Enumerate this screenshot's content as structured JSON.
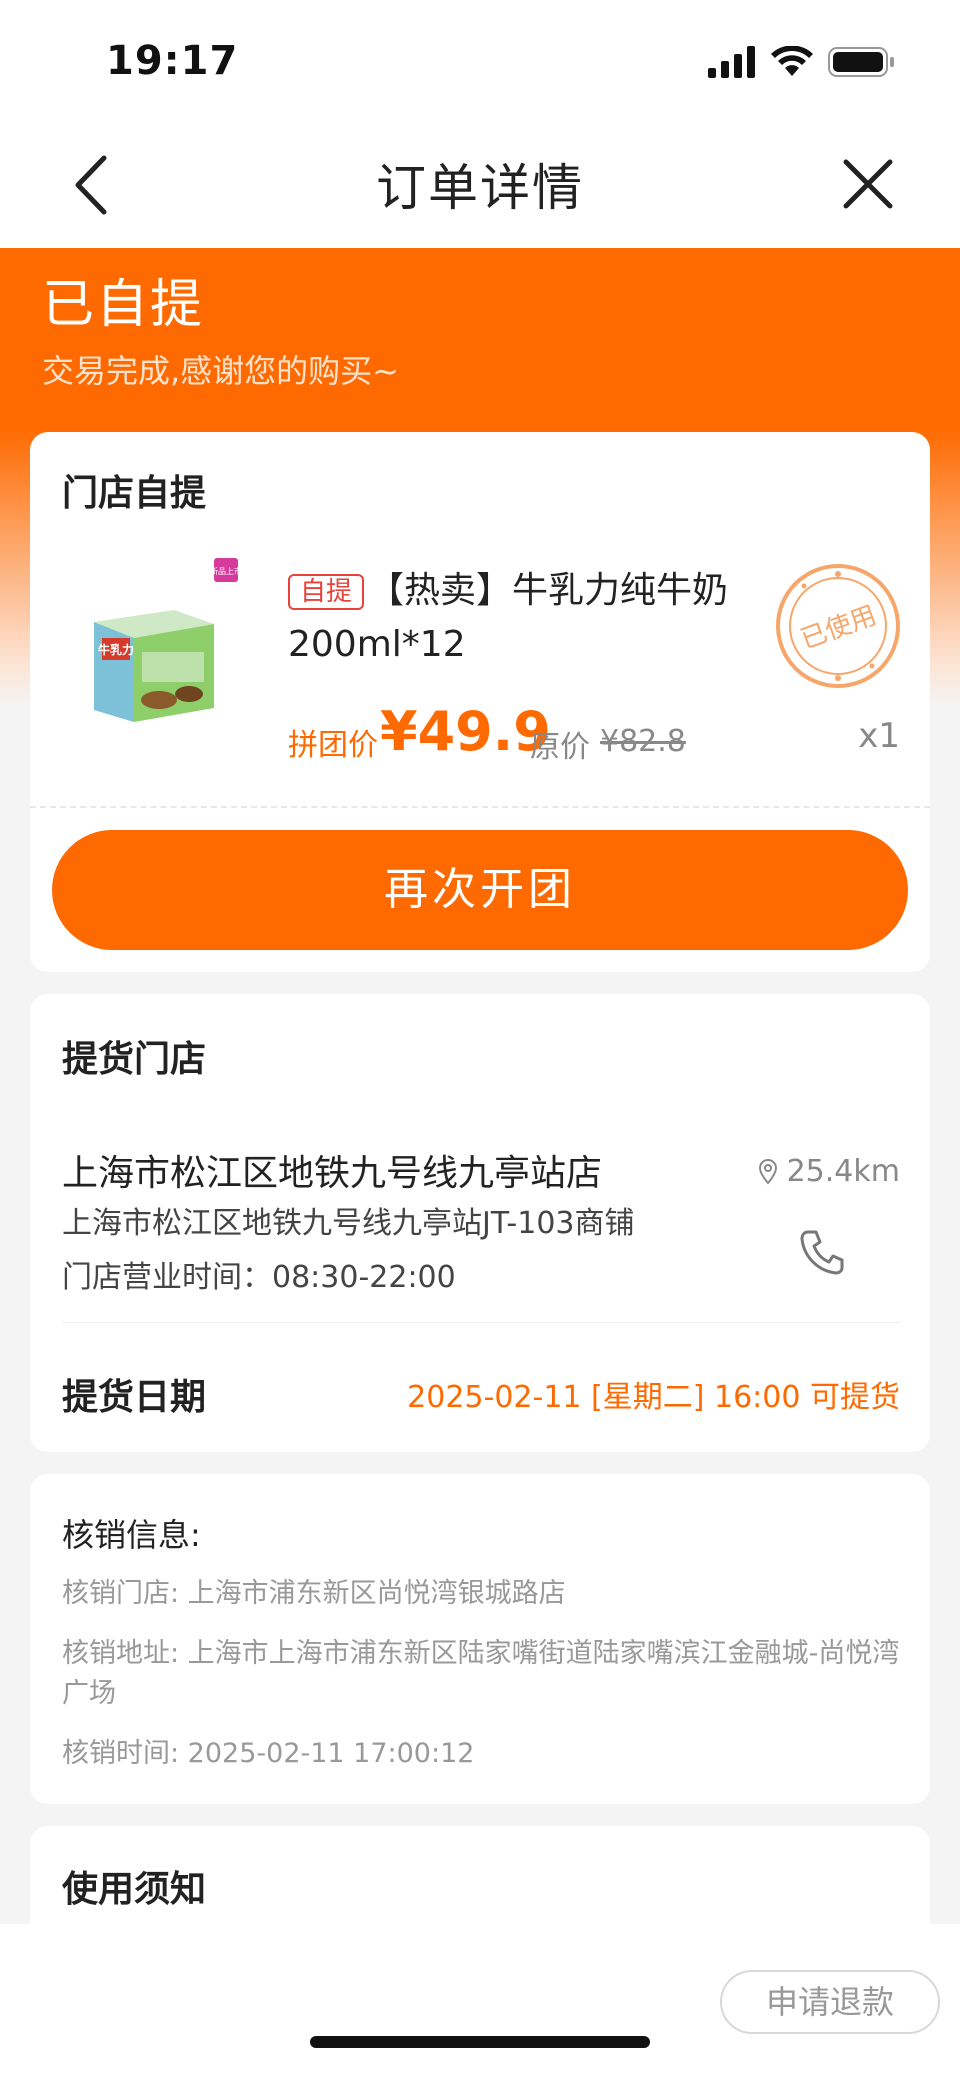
{
  "status_bar": {
    "time": "19:17"
  },
  "nav": {
    "title": "订单详情"
  },
  "order_status": {
    "title": "已自提",
    "subtitle": "交易完成,感谢您的购买~"
  },
  "pickup_card": {
    "title": "门店自提",
    "product": {
      "tag": "自提",
      "name": "【热卖】牛乳力纯牛奶200ml*12",
      "price_label": "拼团价",
      "price": "¥49.9",
      "original_label": "原价",
      "original_price": "¥82.8",
      "quantity": "x1",
      "stamp": "已使用",
      "image_text": "牛乳力",
      "image_badge": "新品上市"
    },
    "button": "再次开团"
  },
  "store_card": {
    "title": "提货门店",
    "store_name": "上海市松江区地铁九号线九亭站店",
    "address": "上海市松江区地铁九号线九亭站JT-103商铺",
    "hours": "门店营业时间：08:30-22:00",
    "distance": "25.4km",
    "date_label": "提货日期",
    "date_value": "2025-02-11 [星期二] 16:00 可提货"
  },
  "verify_card": {
    "title": "核销信息:",
    "store": "核销门店: 上海市浦东新区尚悦湾银城路店",
    "address": "核销地址: 上海市上海市浦东新区陆家嘴街道陆家嘴滨江金融城-尚悦湾广场",
    "time": "核销时间: 2025-02-11 17:00:12"
  },
  "notice_card": {
    "title": "使用须知"
  },
  "bottom_bar": {
    "refund": "申请退款"
  },
  "colors": {
    "accent": "#ff6a00",
    "tag_red": "#e8433a"
  }
}
